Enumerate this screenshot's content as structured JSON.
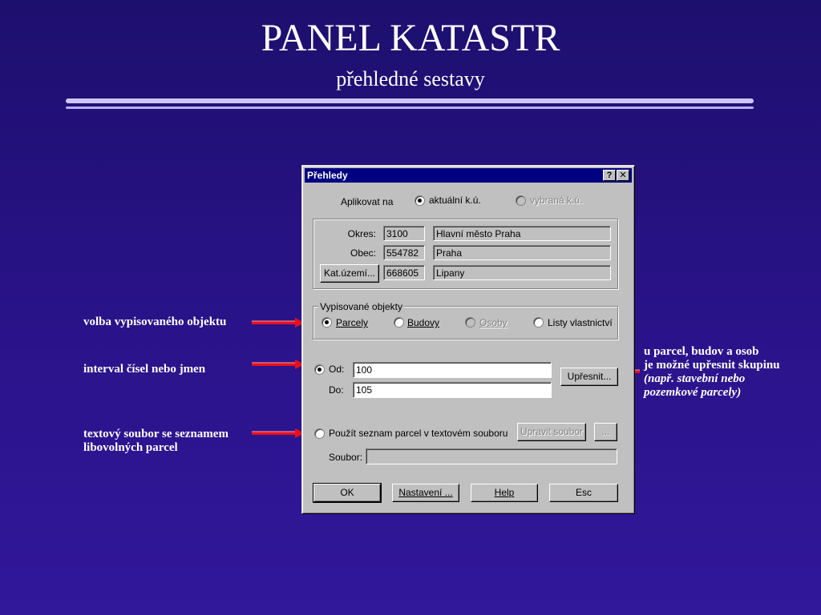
{
  "slide": {
    "title": "PANEL KATASTR",
    "subtitle": "přehledné sestavy"
  },
  "notes": {
    "object_choice": "volba vypisovaného objektu",
    "interval": "interval čísel nebo jmen",
    "textfile_line1": "textový soubor se seznamem",
    "textfile_line2": "libovolných parcel",
    "refine_line1": "u parcel, budov a osob",
    "refine_line2": "je možné upřesnit skupinu",
    "refine_line3": "(např. stavební nebo",
    "refine_line4": "pozemkové parcely)"
  },
  "colors": {
    "arrow": "#e8101c",
    "titlebar": "#000080"
  },
  "dialog": {
    "title": "Přehledy",
    "help_glyph": "?",
    "close_glyph": "✕",
    "apply_label": "Aplikovat na",
    "apply_current": "aktuální k.ú.",
    "apply_selected": "vybraná k.ú.",
    "okres_label": "Okres:",
    "okres_code": "3100",
    "okres_name": "Hlavní město Praha",
    "obec_label": "Obec:",
    "obec_code": "554782",
    "obec_name": "Praha",
    "ku_button": "Kat.území...",
    "ku_code": "668605",
    "ku_name": "Lipany",
    "objects_group": "Vypisované objekty",
    "obj_parcely": "Parcely",
    "obj_budovy": "Budovy",
    "obj_osoby": "Osoby",
    "obj_listy": "Listy vlastnictví",
    "od_label": "Od:",
    "od_value": "100",
    "do_label": "Do:",
    "do_value": "105",
    "refine_button": "Upřesnit...",
    "use_list_label": "Použít seznam parcel v textovém souboru",
    "edit_file_button": "Upravit soubor",
    "browse_button": "...",
    "file_label": "Soubor:",
    "file_value": "",
    "ok_button": "OK",
    "settings_button": "Nastavení ...",
    "help_button": "Help",
    "esc_button": "Esc"
  }
}
